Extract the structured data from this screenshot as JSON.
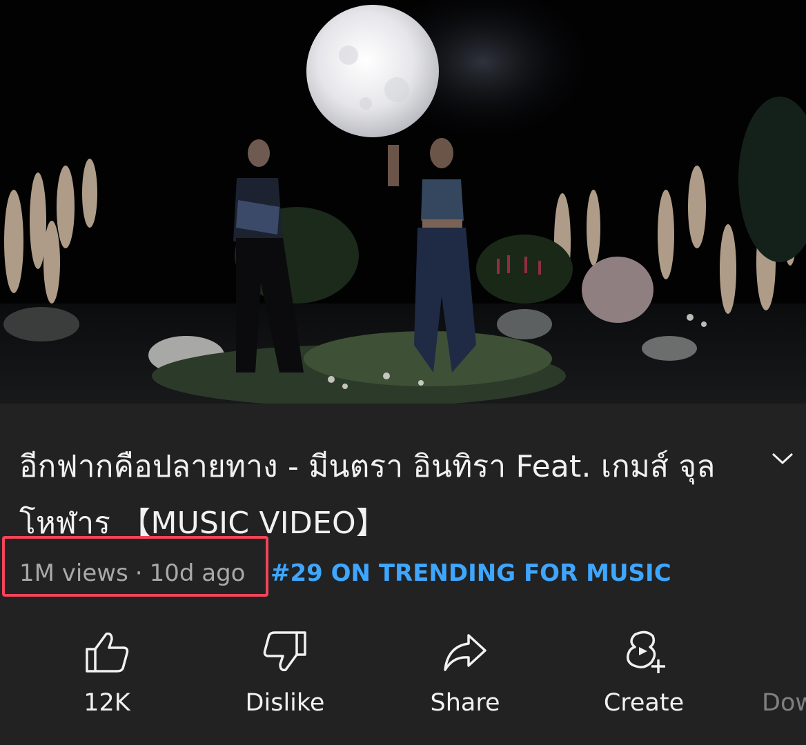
{
  "video": {
    "title": "อีกฟากคือปลายทาง - มีนตรา อินทิรา Feat. เกมส์ จุลโหฬาร 【MUSIC VIDEO】",
    "views": "1M views",
    "separator": "·",
    "age": "10d ago",
    "trending": "#29 ON TRENDING FOR MUSIC"
  },
  "actions": {
    "like_label": "12K",
    "dislike_label": "Dislike",
    "share_label": "Share",
    "create_label": "Create",
    "download_label": "Dow"
  },
  "icons": {
    "expand": "chevron-down-icon",
    "like": "thumb-up-icon",
    "dislike": "thumb-down-icon",
    "share": "share-arrow-icon",
    "create": "create-icon"
  },
  "colors": {
    "background": "#222222",
    "text": "#f1f1f1",
    "secondary_text": "#a9a9a9",
    "link": "#3ea6ff",
    "highlight": "#f0455b"
  }
}
